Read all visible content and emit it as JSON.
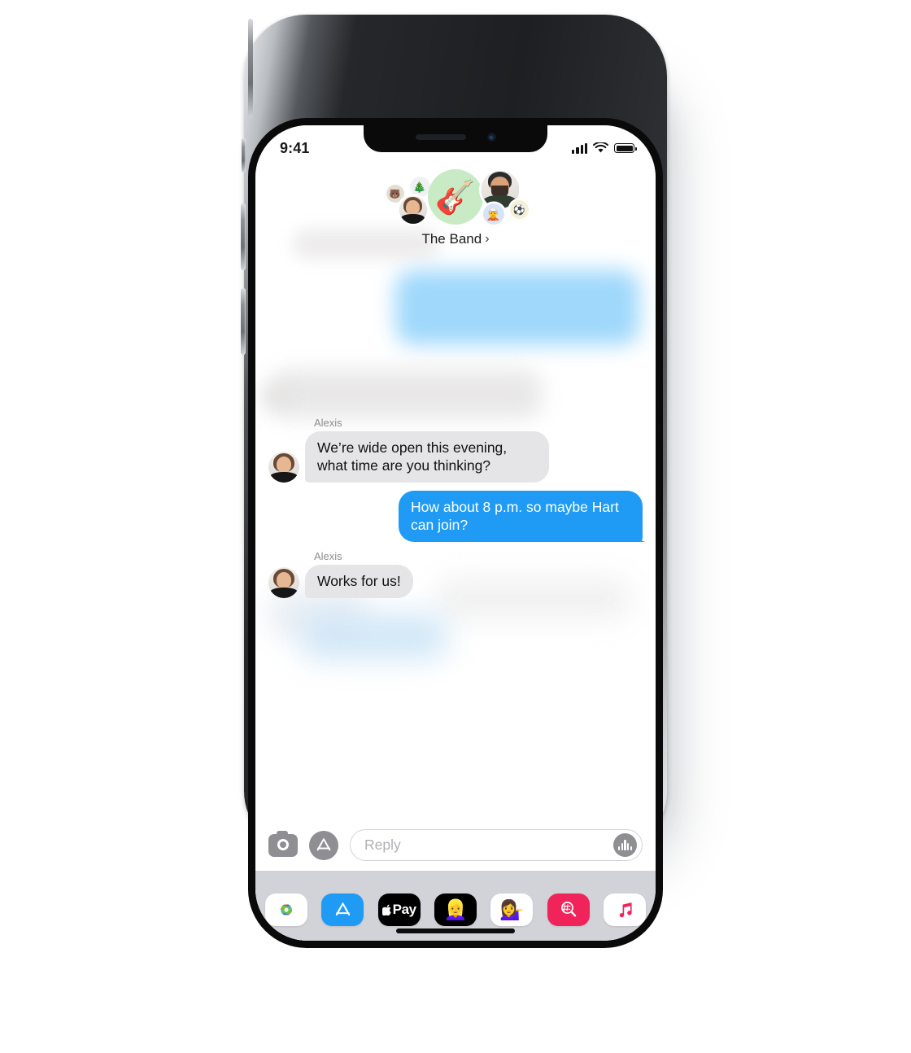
{
  "device": {
    "model": "iphone-x",
    "side_buttons": [
      "mute-switch",
      "volume-up",
      "volume-down",
      "power"
    ]
  },
  "status_bar": {
    "time": "9:41",
    "cellular_icon": "signal-bars-icon",
    "wifi_icon": "wifi-icon",
    "battery_icon": "battery-full-icon",
    "signal_bars": 4,
    "battery_level": 100
  },
  "conversation": {
    "group": {
      "name": "The Band",
      "chevron": "›",
      "main_avatar_icon": "guitar-emoji",
      "main_avatar_glyph": "🎸",
      "main_avatar_bg": "#c8ebc5",
      "participants": [
        {
          "name": "participant-1",
          "type": "memoji-sticker",
          "glyph": "🐻"
        },
        {
          "name": "participant-2",
          "type": "memoji-sticker",
          "glyph": "🎄"
        },
        {
          "name": "participant-3",
          "type": "photo",
          "subject": "woman"
        },
        {
          "name": "participant-4",
          "type": "photo",
          "subject": "man"
        },
        {
          "name": "participant-5",
          "type": "memoji-sticker",
          "glyph": "🧝"
        },
        {
          "name": "participant-6",
          "type": "emoji-sticker",
          "glyph": "⚽"
        }
      ]
    },
    "messages": [
      {
        "id": "msg-1",
        "direction": "incoming",
        "sender": "Alexis",
        "text": "We’re wide open this evening, what time are you thinking?",
        "has_avatar": true,
        "blurred": false
      },
      {
        "id": "msg-2",
        "direction": "outgoing",
        "sender": "",
        "text": "How about 8 p.m. so maybe Hart can join?",
        "has_avatar": false,
        "blurred": false
      },
      {
        "id": "msg-3",
        "direction": "incoming",
        "sender": "Alexis",
        "text": "Works for us!",
        "has_avatar": true,
        "blurred": false
      }
    ]
  },
  "input_bar": {
    "camera_icon": "camera-icon",
    "appstore_icon": "app-store-icon",
    "placeholder": "Reply",
    "value": "",
    "audio_icon": "audio-waveform-icon"
  },
  "app_drawer": {
    "apps": [
      {
        "name": "photos-app",
        "icon": "photos-icon",
        "bg": "#ffffff"
      },
      {
        "name": "app-store-app",
        "icon": "app-store-icon",
        "bg": "#1f9bf5"
      },
      {
        "name": "apple-pay-app",
        "icon": "apple-pay-icon",
        "label": "Pay",
        "bg": "#000000"
      },
      {
        "name": "memoji-app",
        "icon": "memoji-face-icon",
        "glyph": "👱‍♀️",
        "bg": "#000000"
      },
      {
        "name": "memoji-stickers-app",
        "icon": "memoji-sticker-icon",
        "glyph": "💁‍♀️",
        "bg": "#ffffff"
      },
      {
        "name": "images-app",
        "icon": "hashtag-images-icon",
        "bg": "#f0245a"
      },
      {
        "name": "music-app",
        "icon": "music-note-icon",
        "glyph": "♫",
        "bg": "#ffffff"
      }
    ]
  },
  "home_indicator": {
    "name": "home-indicator"
  },
  "colors": {
    "outgoing_bubble": "#1f9bf5",
    "incoming_bubble": "#e5e5e7",
    "drawer_bg": "#d1d3d9",
    "group_avatar_bg": "#c8ebc5",
    "sender_label": "#8e8e93"
  }
}
